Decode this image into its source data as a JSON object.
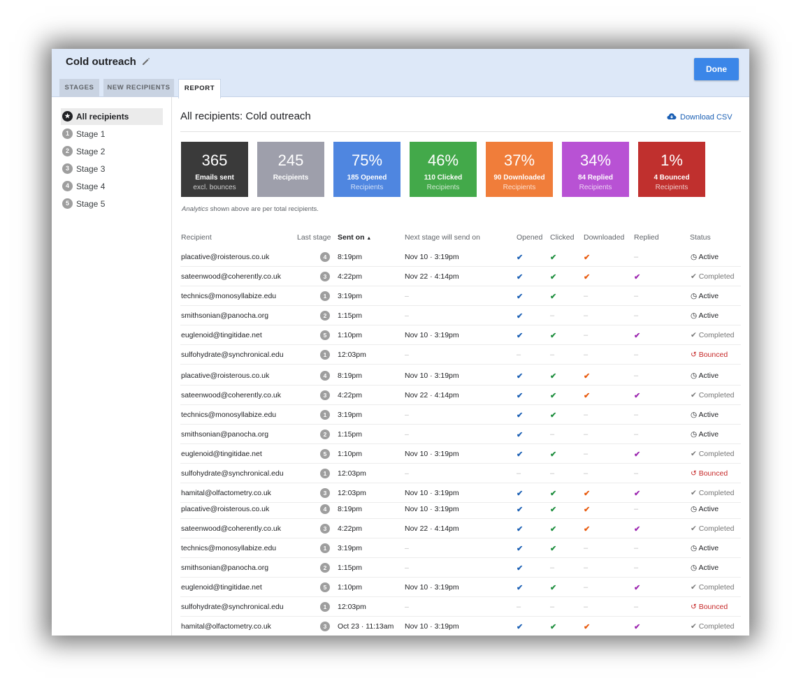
{
  "header": {
    "title": "Cold outreach",
    "done_label": "Done"
  },
  "tabs": [
    {
      "label": "STAGES"
    },
    {
      "label": "NEW RECIPIENTS"
    },
    {
      "label": "REPORT"
    }
  ],
  "sidebar": {
    "items": [
      {
        "badge": "★",
        "label": "All recipients"
      },
      {
        "badge": "1",
        "label": "Stage 1"
      },
      {
        "badge": "2",
        "label": "Stage 2"
      },
      {
        "badge": "3",
        "label": "Stage 3"
      },
      {
        "badge": "4",
        "label": "Stage 4"
      },
      {
        "badge": "5",
        "label": "Stage 5"
      }
    ]
  },
  "main": {
    "title": "All recipients: Cold outreach",
    "download_label": "Download CSV",
    "analytics_note_em": "Analytics",
    "analytics_note_rest": " shown above are per total recipients."
  },
  "cards": [
    {
      "value": "365",
      "line1": "Emails sent",
      "line2": "excl. bounces",
      "color": "#3a3a3a"
    },
    {
      "value": "245",
      "line1": "Recipients",
      "line2": "",
      "color": "#9e9fab"
    },
    {
      "value": "75%",
      "line1": "185 Opened",
      "line2": "Recipients",
      "color": "#4f86e0"
    },
    {
      "value": "46%",
      "line1": "110 Clicked",
      "line2": "Recipients",
      "color": "#43a94a"
    },
    {
      "value": "37%",
      "line1": "90 Downloaded",
      "line2": "Recipients",
      "color": "#f07d3a"
    },
    {
      "value": "34%",
      "line1": "84 Replied",
      "line2": "Recipients",
      "color": "#b852d4"
    },
    {
      "value": "1%",
      "line1": "4 Bounced",
      "line2": "Recipients",
      "color": "#c0302e"
    }
  ],
  "table": {
    "headers": {
      "recipient": "Recipient",
      "last_stage": "Last stage",
      "sent_on": "Sent on",
      "next_stage": "Next stage will send on",
      "opened": "Opened",
      "clicked": "Clicked",
      "downloaded": "Downloaded",
      "replied": "Replied",
      "status": "Status"
    },
    "rows": [
      {
        "recipient": "placative@roisterous.co.uk",
        "stage": "4",
        "sent": "8:19pm",
        "next": "Nov 10 · 3:19pm",
        "opened": true,
        "clicked": true,
        "downloaded": true,
        "replied": false,
        "status": "Active"
      },
      {
        "recipient": "sateenwood@coherently.co.uk",
        "stage": "3",
        "sent": "4:22pm",
        "next": "Nov 22 · 4:14pm",
        "opened": true,
        "clicked": true,
        "downloaded": true,
        "replied": true,
        "status": "Completed"
      },
      {
        "recipient": "technics@monosyllabize.edu",
        "stage": "1",
        "sent": "3:19pm",
        "next": "–",
        "opened": true,
        "clicked": true,
        "downloaded": false,
        "replied": false,
        "status": "Active"
      },
      {
        "recipient": "smithsonian@panocha.org",
        "stage": "2",
        "sent": "1:15pm",
        "next": "–",
        "opened": true,
        "clicked": false,
        "downloaded": false,
        "replied": false,
        "status": "Active"
      },
      {
        "recipient": "euglenoid@tingitidae.net",
        "stage": "5",
        "sent": "1:10pm",
        "next": "Nov 10 · 3:19pm",
        "opened": true,
        "clicked": true,
        "downloaded": false,
        "replied": true,
        "status": "Completed"
      },
      {
        "recipient": "sulfohydrate@synchronical.edu",
        "stage": "1",
        "sent": "12:03pm",
        "next": "–",
        "opened": false,
        "clicked": false,
        "downloaded": false,
        "replied": false,
        "status": "Bounced"
      },
      {
        "recipient": "placative@roisterous.co.uk",
        "stage": "4",
        "sent": "8:19pm",
        "next": "Nov 10 · 3:19pm",
        "opened": true,
        "clicked": true,
        "downloaded": true,
        "replied": false,
        "status": "Active"
      },
      {
        "recipient": "sateenwood@coherently.co.uk",
        "stage": "3",
        "sent": "4:22pm",
        "next": "Nov 22 · 4:14pm",
        "opened": true,
        "clicked": true,
        "downloaded": true,
        "replied": true,
        "status": "Completed"
      },
      {
        "recipient": "technics@monosyllabize.edu",
        "stage": "1",
        "sent": "3:19pm",
        "next": "–",
        "opened": true,
        "clicked": true,
        "downloaded": false,
        "replied": false,
        "status": "Active"
      },
      {
        "recipient": "smithsonian@panocha.org",
        "stage": "2",
        "sent": "1:15pm",
        "next": "–",
        "opened": true,
        "clicked": false,
        "downloaded": false,
        "replied": false,
        "status": "Active"
      },
      {
        "recipient": "euglenoid@tingitidae.net",
        "stage": "5",
        "sent": "1:10pm",
        "next": "Nov 10 · 3:19pm",
        "opened": true,
        "clicked": true,
        "downloaded": false,
        "replied": true,
        "status": "Completed"
      },
      {
        "recipient": "sulfohydrate@synchronical.edu",
        "stage": "1",
        "sent": "12:03pm",
        "next": "–",
        "opened": false,
        "clicked": false,
        "downloaded": false,
        "replied": false,
        "status": "Bounced"
      },
      {
        "recipient": "hamital@olfactometry.co.uk",
        "stage": "3",
        "sent": "12:03pm",
        "next": "Nov 10 · 3:19pm",
        "opened": true,
        "clicked": true,
        "downloaded": true,
        "replied": true,
        "status": "Completed"
      },
      {
        "recipient": "placative@roisterous.co.uk",
        "stage": "4",
        "sent": "8:19pm",
        "next": "Nov 10 · 3:19pm",
        "opened": true,
        "clicked": true,
        "downloaded": true,
        "replied": false,
        "status": "Active"
      },
      {
        "recipient": "sateenwood@coherently.co.uk",
        "stage": "3",
        "sent": "4:22pm",
        "next": "Nov 22 · 4:14pm",
        "opened": true,
        "clicked": true,
        "downloaded": true,
        "replied": true,
        "status": "Completed"
      },
      {
        "recipient": "technics@monosyllabize.edu",
        "stage": "1",
        "sent": "3:19pm",
        "next": "–",
        "opened": true,
        "clicked": true,
        "downloaded": false,
        "replied": false,
        "status": "Active"
      },
      {
        "recipient": "smithsonian@panocha.org",
        "stage": "2",
        "sent": "1:15pm",
        "next": "–",
        "opened": true,
        "clicked": false,
        "downloaded": false,
        "replied": false,
        "status": "Active"
      },
      {
        "recipient": "euglenoid@tingitidae.net",
        "stage": "5",
        "sent": "1:10pm",
        "next": "Nov 10 · 3:19pm",
        "opened": true,
        "clicked": true,
        "downloaded": false,
        "replied": true,
        "status": "Completed"
      },
      {
        "recipient": "sulfohydrate@synchronical.edu",
        "stage": "1",
        "sent": "12:03pm",
        "next": "–",
        "opened": false,
        "clicked": false,
        "downloaded": false,
        "replied": false,
        "status": "Bounced"
      },
      {
        "recipient": "hamital@olfactometry.co.uk",
        "stage": "3",
        "sent": "Oct 23 · 11:13am",
        "next": "Nov 10 · 3:19pm",
        "opened": true,
        "clicked": true,
        "downloaded": true,
        "replied": true,
        "status": "Completed"
      }
    ]
  },
  "icons": {
    "opened": "check-blue",
    "clicked": "check-green",
    "downloaded": "check-orange",
    "replied": "check-purple",
    "empty": "dash"
  },
  "colors": {
    "accent": "#3b86e8",
    "header_bg": "#dde8f8",
    "opened": "#1a5fb4",
    "clicked": "#1e8e3e",
    "downloaded": "#e8590c",
    "replied": "#9c27b0",
    "bounced": "#c62828"
  }
}
